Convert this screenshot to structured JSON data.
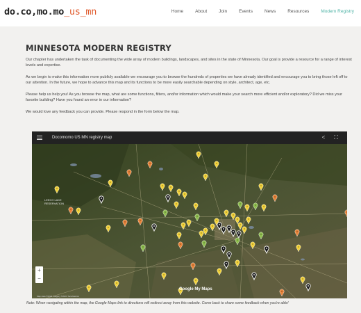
{
  "header": {
    "logo_main": "do.co,mo.mo",
    "logo_sub": "_us_mn",
    "nav": [
      {
        "label": "Home"
      },
      {
        "label": "About"
      },
      {
        "label": "Join"
      },
      {
        "label": "Events"
      },
      {
        "label": "News"
      },
      {
        "label": "Resources"
      },
      {
        "label": "Modern Registry",
        "active": true
      }
    ],
    "active_color": "#4fb3a6",
    "accent_color": "#e05a2c"
  },
  "main": {
    "title": "MINNESOTA MODERN REGISTRY",
    "paragraphs": [
      "Our chapter has undertaken the task of documenting the wide array of modern buildings, landscapes, and sites in the state of Minnesota. Our goal is provide a resource for a range of interest levels and expertise.",
      "As we begin to make this information more publicly available we encourage you to browse the hundreds of properties we have already identified and encourage you to bring those left off to our attention. In the future, we hope to advance this map and its functions to be more easily searchable depending on style, architect, age, etc.",
      "Please help us help you! As you browse the map, what are some functions, filters, and/or information which would make your search more efficient and/or exploratory? Did we miss your favorite building? Have you found an error in our information?",
      "We would love any feedback you can provide. Please respond in the form below the map."
    ]
  },
  "map": {
    "title": "Docomomo US MN registry map",
    "region_label": "LEECH LAKE\nRESERVATION",
    "zoom_in": "+",
    "zoom_out": "−",
    "google_label": "Google My Maps",
    "attribution": "Map data ©2023 Imagery ©2023 TerraMetrics",
    "pin_colors": {
      "yellow": "#f2d23b",
      "orange": "#e8843a",
      "green": "#8fbf4f",
      "black": "#1a1a1a"
    }
  },
  "footer": {
    "note": "Note: When navigating within the map, the Google Maps link to directions will redirect away from this website. Come back to share some feedback when you're able!"
  }
}
